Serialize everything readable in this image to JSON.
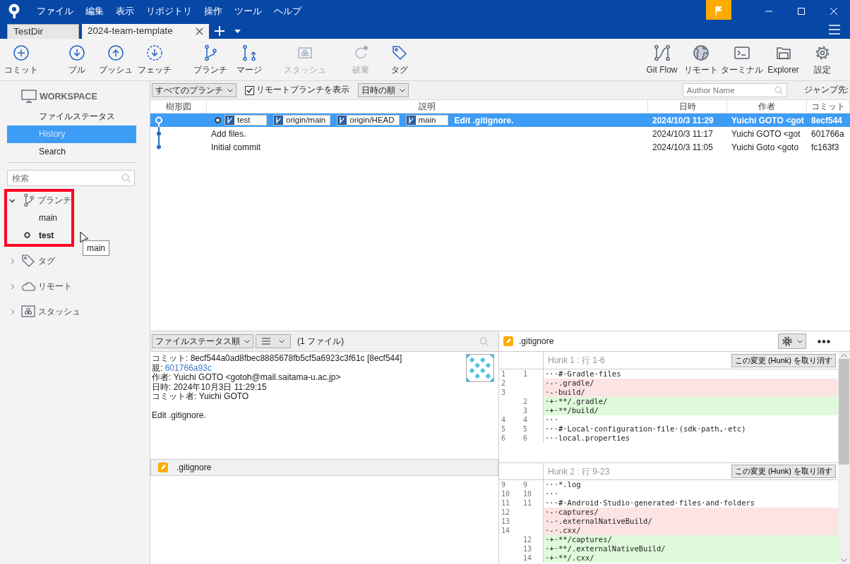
{
  "menu": [
    "ファイル",
    "編集",
    "表示",
    "リポジトリ",
    "操作",
    "ツール",
    "ヘルプ"
  ],
  "repo_tabs": [
    {
      "label": "TestDir",
      "selected": false
    },
    {
      "label": "2024-team-template",
      "selected": true
    }
  ],
  "toolbar_left": [
    {
      "label": "コミット",
      "disabled": false
    },
    {
      "label": "プル",
      "disabled": false
    },
    {
      "label": "プッシュ",
      "disabled": false
    },
    {
      "label": "フェッチ",
      "disabled": false
    },
    {
      "label": "ブランチ",
      "disabled": false
    },
    {
      "label": "マージ",
      "disabled": false
    },
    {
      "label": "スタッシュ",
      "disabled": true
    },
    {
      "label": "破棄",
      "disabled": true
    },
    {
      "label": "タグ",
      "disabled": false
    }
  ],
  "toolbar_right": [
    {
      "label": "Git Flow",
      "disabled": false
    },
    {
      "label": "リモート",
      "disabled": false
    },
    {
      "label": "ターミナル",
      "disabled": false
    },
    {
      "label": "Explorer",
      "disabled": false
    },
    {
      "label": "設定",
      "disabled": false
    }
  ],
  "sidebar": {
    "workspace_title": "WORKSPACE",
    "items": [
      {
        "label": "ファイルステータス",
        "selected": false
      },
      {
        "label": "History",
        "selected": true
      },
      {
        "label": "Search",
        "selected": false
      }
    ],
    "search": {
      "placeholder": "検索"
    },
    "tree": [
      {
        "label": "ブランチ",
        "expanded": true,
        "highlighted": true,
        "children": [
          {
            "label": "main",
            "current": false
          },
          {
            "label": "test",
            "current": true
          }
        ]
      },
      {
        "label": "タグ",
        "expanded": false,
        "highlighted": false
      },
      {
        "label": "リモート",
        "expanded": false,
        "highlighted": false
      },
      {
        "label": "スタッシュ",
        "expanded": false,
        "highlighted": false
      }
    ]
  },
  "tooltip": {
    "text": "main"
  },
  "history": {
    "branch_filter": "すべてのブランチ",
    "show_remote": {
      "label": "リモートブランチを表示",
      "checked": true
    },
    "order_filter": "日時の順",
    "author_search": {
      "placeholder": "Author Name"
    },
    "jump_label": "ジャンプ先:",
    "columns": [
      "樹形図",
      "説明",
      "日時",
      "作者",
      "コミット"
    ],
    "rows": [
      {
        "selected": true,
        "head": true,
        "refs": [
          {
            "name": "test",
            "current": true
          },
          {
            "name": "origin/main",
            "current": false
          },
          {
            "name": "origin/HEAD",
            "current": false
          },
          {
            "name": "main",
            "current": false
          }
        ],
        "description": "Edit .gitignore.",
        "date": "2024/10/3  11:29",
        "author": "Yuichi GOTO <got",
        "commit": "8ecf544"
      },
      {
        "selected": false,
        "head": false,
        "description": "Add files.",
        "date": "2024/10/3  11:17",
        "author": "Yuichi GOTO <got",
        "commit": "601766a"
      },
      {
        "selected": false,
        "head": false,
        "description": "Initial commit",
        "date": "2024/10/3  11:05",
        "author": "Yuichi Goto <goto",
        "commit": "fc163f3"
      }
    ]
  },
  "details": {
    "sort_filter": "ファイルステータス順",
    "file_count": "(1 ファイル)",
    "fields": [
      {
        "label": "コミット:",
        "value": "8ecf544a0ad8fbec8885678fb5cf5a6923c3f61c [8ecf544]",
        "kind": "text"
      },
      {
        "label": "親:",
        "value": "601766a93c",
        "kind": "link"
      },
      {
        "label": "作者:",
        "value": "Yuichi GOTO <gotoh@mail.saitama-u.ac.jp>",
        "kind": "text"
      },
      {
        "label": "日時:",
        "value": "2024年10月3日 11:29:15",
        "kind": "text"
      },
      {
        "label": "コミット者:",
        "value": "Yuichi GOTO",
        "kind": "text"
      }
    ],
    "message": "Edit .gitignore.",
    "files": [
      {
        "name": ".gitignore"
      }
    ]
  },
  "diff": {
    "file": ".gitignore",
    "hunks": [
      {
        "title": "Hunk 1 : 行 1-6",
        "action": "この変更 (Hunk) を取り消す",
        "lines": [
          {
            "kind": "context",
            "old": "1",
            "new": "1",
            "text": "···#·Gradle·files"
          },
          {
            "kind": "removed",
            "old": "2",
            "text": "·-·.gradle/"
          },
          {
            "kind": "removed",
            "old": "3",
            "text": "·-·build/"
          },
          {
            "kind": "added",
            "new": "2",
            "text": "·+·**/.gradle/"
          },
          {
            "kind": "added",
            "new": "3",
            "text": "·+·**/build/"
          },
          {
            "kind": "context",
            "old": "4",
            "new": "4",
            "text": "···"
          },
          {
            "kind": "context",
            "old": "5",
            "new": "5",
            "text": "···#·Local·configuration·file·(sdk·path,·etc)"
          },
          {
            "kind": "context",
            "old": "6",
            "new": "6",
            "text": "···local.properties"
          }
        ]
      },
      {
        "title": "Hunk 2 : 行 9-23",
        "action": "この変更 (Hunk) を取り消す",
        "lines": [
          {
            "kind": "context",
            "old": "9",
            "new": "9",
            "text": "···*.log"
          },
          {
            "kind": "context",
            "old": "10",
            "new": "10",
            "text": "···"
          },
          {
            "kind": "context",
            "old": "11",
            "new": "11",
            "text": "···#·Android·Studio·generated·files·and·folders"
          },
          {
            "kind": "removed",
            "old": "12",
            "text": "·-·captures/"
          },
          {
            "kind": "removed",
            "old": "13",
            "text": "·-·.externalNativeBuild/"
          },
          {
            "kind": "removed",
            "old": "14",
            "text": "·-·.cxx/"
          },
          {
            "kind": "added",
            "new": "12",
            "text": "·+·**/captures/"
          },
          {
            "kind": "added",
            "new": "13",
            "text": "·+·**/.externalNativeBuild/"
          },
          {
            "kind": "added",
            "new": "14",
            "text": "·+·**/.cxx/"
          }
        ]
      }
    ]
  }
}
